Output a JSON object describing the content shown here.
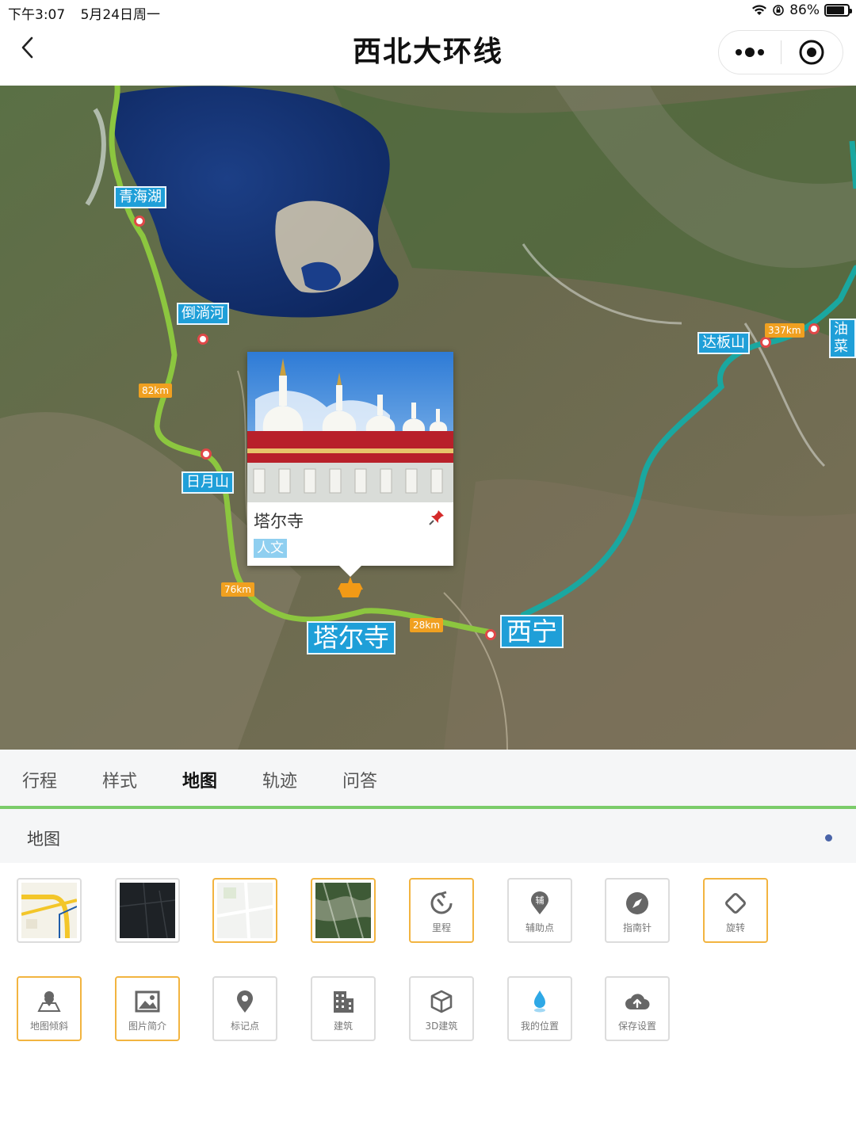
{
  "status_bar": {
    "time": "下午3:07",
    "date": "5月24日周一",
    "battery": "86%",
    "battery_level": 0.86
  },
  "nav": {
    "title": "西北大环线"
  },
  "map": {
    "places": [
      {
        "name": "青海湖"
      },
      {
        "name": "倒淌河"
      },
      {
        "name": "日月山"
      },
      {
        "name": "塔尔寺"
      },
      {
        "name": "西宁"
      },
      {
        "name": "达板山"
      },
      {
        "name": "油菜"
      }
    ],
    "distances": [
      "82km",
      "76km",
      "28km",
      "337km"
    ],
    "route_colors": {
      "west": "#8cc63f",
      "east": "#1aa7a0"
    },
    "popup": {
      "name": "塔尔寺",
      "tag": "人文"
    }
  },
  "tabs": [
    "行程",
    "样式",
    "地图",
    "轨迹",
    "问答"
  ],
  "active_tab": "地图",
  "section": {
    "title": "地图"
  },
  "tools_row1": [
    {
      "kind": "thumb",
      "style": "standard-map",
      "selected": false
    },
    {
      "kind": "thumb",
      "style": "dark-map",
      "selected": false
    },
    {
      "kind": "thumb",
      "style": "light-map",
      "selected": true
    },
    {
      "kind": "thumb",
      "style": "satellite-map",
      "selected": true
    },
    {
      "kind": "tool",
      "label": "里程",
      "icon": "mileage-icon",
      "selected": true
    },
    {
      "kind": "tool",
      "label": "辅助点",
      "icon": "auxiliary-point-icon",
      "selected": false
    },
    {
      "kind": "tool",
      "label": "指南针",
      "icon": "compass-icon",
      "selected": false
    },
    {
      "kind": "tool",
      "label": "旋转",
      "icon": "rotate-icon",
      "selected": true
    }
  ],
  "tools_row2": [
    {
      "label": "地图倾斜",
      "icon": "map-tilt-icon",
      "selected": true
    },
    {
      "label": "图片简介",
      "icon": "image-intro-icon",
      "selected": true
    },
    {
      "label": "标记点",
      "icon": "marker-icon",
      "selected": false
    },
    {
      "label": "建筑",
      "icon": "building-icon",
      "selected": false
    },
    {
      "label": "3D建筑",
      "icon": "cube-icon",
      "selected": false
    },
    {
      "label": "我的位置",
      "icon": "my-location-icon",
      "selected": false
    },
    {
      "label": "保存设置",
      "icon": "cloud-upload-icon",
      "selected": false
    }
  ]
}
